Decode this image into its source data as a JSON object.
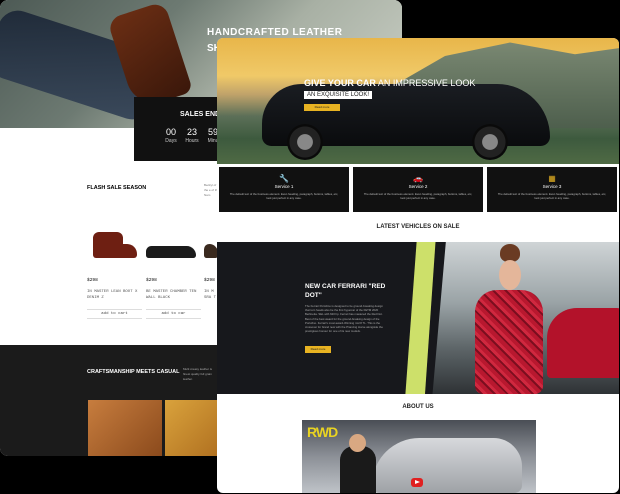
{
  "leather_site": {
    "hero_title_line1": "HANDCRAFTED LEATHER",
    "hero_title_line2": "SH",
    "sale_title": "SALES END I",
    "countdown": [
      {
        "value": "00",
        "label": "Days"
      },
      {
        "value": "23",
        "label": "Hours"
      },
      {
        "value": "59",
        "label": "Minu"
      }
    ],
    "flash_title": "FLASH SALE SEASON",
    "side_text": "Beckyl of the e of the Nam",
    "products": [
      {
        "price": "$298",
        "name": "IN MASTER LEAN BOOT X DENIM Z",
        "button": "add to cart",
        "color": "#6e1f12"
      },
      {
        "price": "$298",
        "name": "BE MASTER CHAMBER TEN WALL BLACK",
        "button": "add to car",
        "color": "#1b1b1b"
      },
      {
        "price": "$298",
        "name": "IN M SRA T",
        "button": "",
        "color": "#3a2a1f"
      }
    ],
    "craft_title": "CRAFTSMANSHIP MEETS CASUAL",
    "craft_text": "Multi creasy leather is finest quality full grain leather."
  },
  "car_site": {
    "hero_title_bold": "GIVE YOUR CAR",
    "hero_title_rest": " AN IMPRESSIVE LOOK",
    "hero_subtitle": "AN EXQUISITE LOOK!",
    "hero_button": "Read more",
    "services": [
      {
        "title": "Service 1",
        "icon": "wrench-icon",
        "glyph": "🔧",
        "text": "The default text of the business element. Even heading, paragraph, buttons, tables, etc, look just perfect in any case."
      },
      {
        "title": "Service 2",
        "icon": "car-icon",
        "glyph": "🚗",
        "text": "The default text of the business element. Even heading, paragraph, buttons, tables, etc, look just perfect in any case."
      },
      {
        "title": "Service 3",
        "icon": "grid-icon",
        "glyph": "▦",
        "text": "The default text of the business element. Even heading, paragraph, buttons, tables, etc, look just perfect in any case."
      }
    ],
    "latest_title": "LATEST VEHICLES ON SALE",
    "ferrari_title": "NEW CAR FERRARI \"RED DOT\"",
    "ferrari_text": "The Ferrari Portofino is designed to be ground-breaking design that turn heads also be the first hypercar of the FETM 2020 Berlinetta. SEL with 620 hp. Ferrari has mastered the Red Dot. Best of the best award for the ground-breaking design of the Portofino. Ferrari's most award-Winning mid 8 TL. This is the crossover for brand new with the Prancing Horse alongside the prestigious honour for one of its new models.",
    "ferrari_button": "Read more",
    "about_title": "ABOUT US",
    "video_logo": "RWD"
  },
  "colors": {
    "accent": "#e8b322",
    "dark": "#111111"
  }
}
